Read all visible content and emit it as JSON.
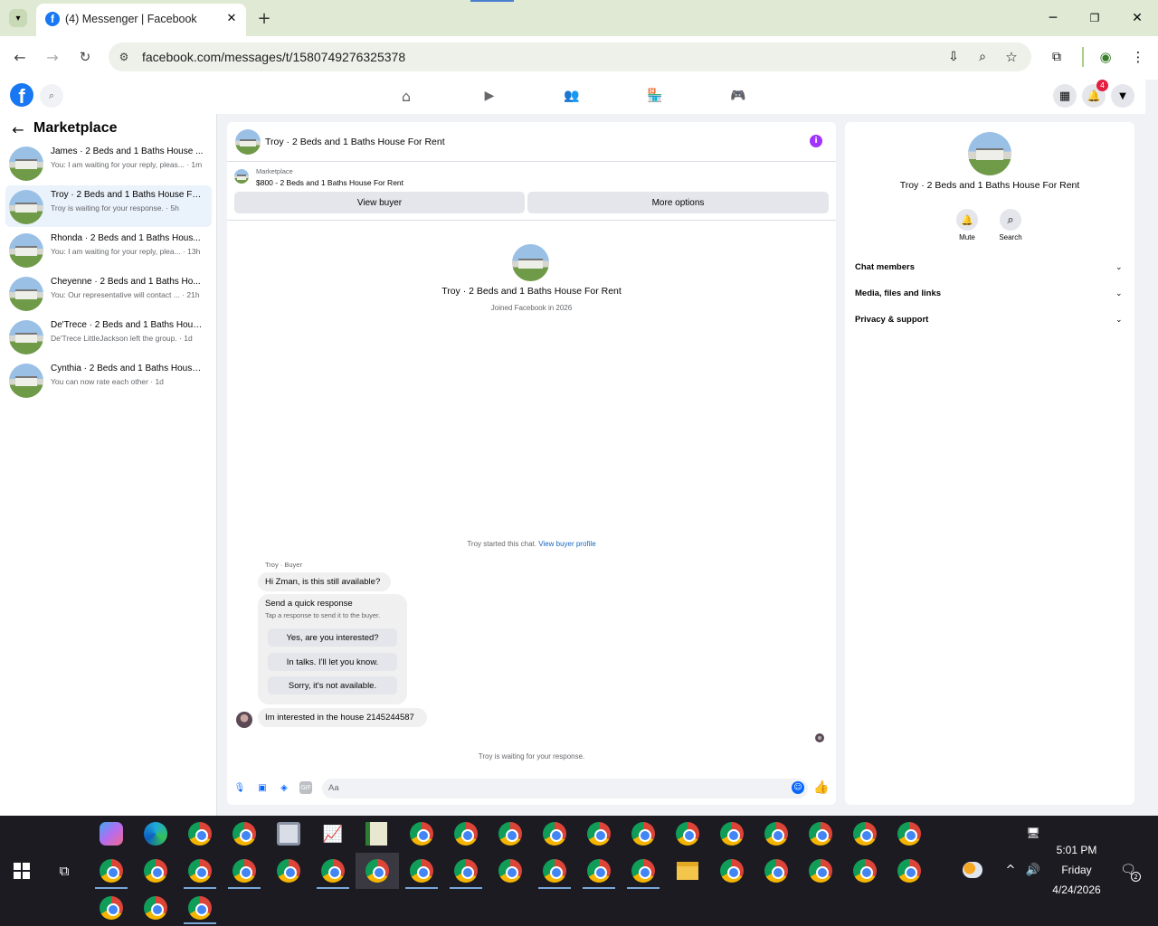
{
  "browser": {
    "tab_title": "(4) Messenger | Facebook",
    "url": "facebook.com/messages/t/1580749276325378"
  },
  "fb": {
    "notification_count": "4"
  },
  "sidebar": {
    "title": "Marketplace",
    "conversations": [
      {
        "name": "James · 2 Beds and 1 Baths House ...",
        "preview": "You: I am waiting for your reply, pleas... · 1m"
      },
      {
        "name": "Troy · 2 Beds and 1 Baths House Fo...",
        "preview": "Troy is waiting for your response. · 5h"
      },
      {
        "name": "Rhonda · 2 Beds and 1 Baths Hous...",
        "preview": "You: I am waiting for your reply, plea... · 13h"
      },
      {
        "name": "Cheyenne · 2 Beds and 1 Baths Ho...",
        "preview": "You: Our representative will contact ... · 21h"
      },
      {
        "name": "De'Trece · 2 Beds and 1 Baths Hous...",
        "preview": "De'Trece LittleJackson left the group. · 1d"
      },
      {
        "name": "Cynthia · 2 Beds and 1 Baths House...",
        "preview": "You can now rate each other · 1d"
      }
    ]
  },
  "chat": {
    "header_title": "Troy · 2 Beds and 1 Baths House For Rent",
    "marketplace_label": "Marketplace",
    "listing": "$800 - 2 Beds and 1 Baths House For Rent",
    "view_buyer": "View buyer",
    "more_options": "More options",
    "profile_name": "Troy · 2 Beds and 1 Baths House For Rent",
    "joined": "Joined Facebook in 2026",
    "started_text": "Troy started this chat.",
    "view_buyer_profile": "View buyer profile",
    "sender_label": "Troy · Buyer",
    "message1": "Hi Zman, is this still available?",
    "quick_title": "Send a quick response",
    "quick_sub": "Tap a response to send it to the buyer.",
    "quick_replies": [
      "Yes, are you interested?",
      "In talks. I'll let you know.",
      "Sorry, it's not available."
    ],
    "message2": "Im interested in the house 2145244587",
    "waiting": "Troy is waiting for your response.",
    "composer_placeholder": "Aa"
  },
  "info": {
    "name": "Troy · 2 Beds and 1 Baths House For Rent",
    "mute": "Mute",
    "search": "Search",
    "sections": [
      "Chat members",
      "Media, files and links",
      "Privacy & support"
    ]
  },
  "taskbar": {
    "time": "5:01 PM",
    "day": "Friday",
    "date": "4/24/2026",
    "notif_count": "2"
  }
}
